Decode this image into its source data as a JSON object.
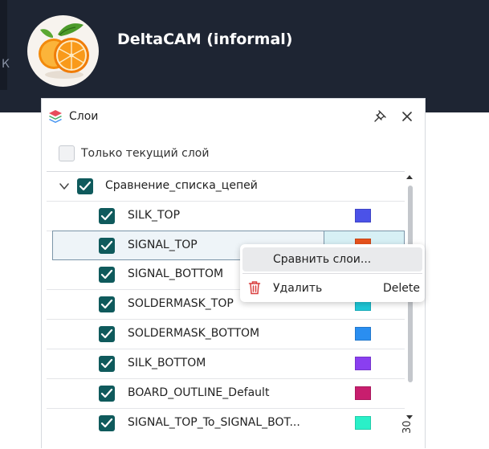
{
  "app": {
    "title": "DeltaCAM (informal)",
    "edge_char": "К"
  },
  "panel": {
    "title": "Слои",
    "only_current_label": "Только текущий слой",
    "only_current_checked": false,
    "group": {
      "label": "Сравнение_списка_цепей",
      "expanded": true,
      "checked": true
    },
    "layers": [
      {
        "label": "SILK_TOP",
        "color": "#4b52e8",
        "checked": true
      },
      {
        "label": "SIGNAL_TOP",
        "color": "#e8521c",
        "checked": true,
        "selected": true
      },
      {
        "label": "SIGNAL_BOTTOM",
        "color": "#e8a33c",
        "checked": true
      },
      {
        "label": "SOLDERMASK_TOP",
        "color": "#1ec8d8",
        "checked": true
      },
      {
        "label": "SOLDERMASK_BOTTOM",
        "color": "#2a8ef0",
        "checked": true
      },
      {
        "label": "SILK_BOTTOM",
        "color": "#8a3ff0",
        "checked": true
      },
      {
        "label": "BOARD_OUTLINE_Default",
        "color": "#c81e6e",
        "checked": true
      },
      {
        "label": "SIGNAL_TOP_To_SIGNAL_BOT...",
        "color": "#2af0c8",
        "checked": true
      }
    ]
  },
  "context_menu": {
    "compare_label": "Сравнить слои...",
    "delete_label": "Удалить",
    "delete_shortcut": "Delete"
  },
  "corner_text": "30",
  "colors": {
    "topbar": "#1e2533",
    "checkbox": "#0f5a5c",
    "trash": "#d94040"
  }
}
